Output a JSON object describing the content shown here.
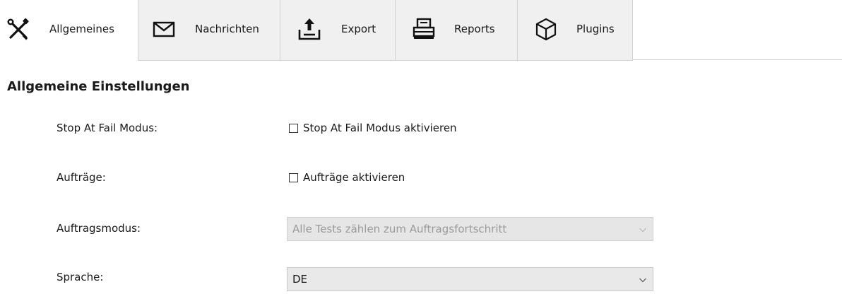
{
  "tabs": [
    {
      "label": "Allgemeines",
      "icon": "tools-icon",
      "active": true
    },
    {
      "label": "Nachrichten",
      "icon": "envelope-icon",
      "active": false
    },
    {
      "label": "Export",
      "icon": "upload-tray-icon",
      "active": false
    },
    {
      "label": "Reports",
      "icon": "printer-icon",
      "active": false
    },
    {
      "label": "Plugins",
      "icon": "cube-icon",
      "active": false
    }
  ],
  "section": {
    "title": "Allgemeine Einstellungen"
  },
  "settings": {
    "stop_at_fail": {
      "label": "Stop At Fail Modus:",
      "checkbox_label": "Stop At Fail Modus aktivieren",
      "checked": false
    },
    "auftraege": {
      "label": "Aufträge:",
      "checkbox_label": "Aufträge aktivieren",
      "checked": false
    },
    "auftragsmodus": {
      "label": "Auftragsmodus:",
      "value": "Alle Tests zählen zum Auftragsfortschritt",
      "disabled": true
    },
    "sprache": {
      "label": "Sprache:",
      "value": "DE",
      "disabled": false
    }
  },
  "colors": {
    "inactive_tab_bg": "#f0f0f0",
    "active_tab_bg": "#ffffff",
    "disabled_text": "#9a9a9a"
  }
}
